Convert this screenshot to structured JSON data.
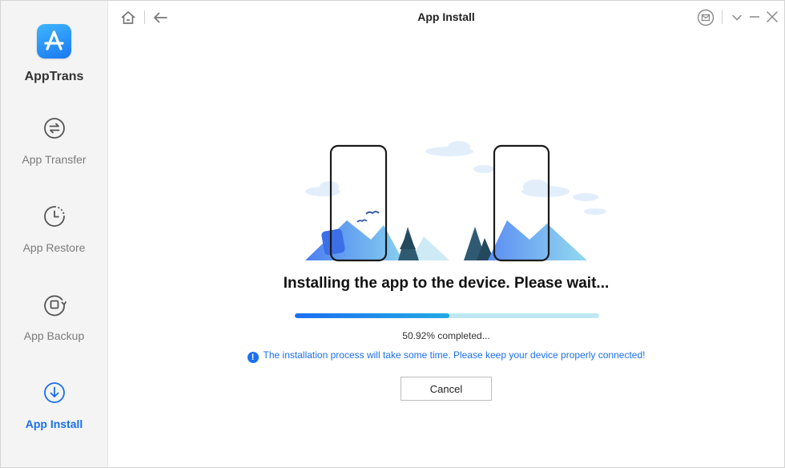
{
  "app": {
    "name": "AppTrans"
  },
  "sidebar": {
    "items": [
      {
        "label": "App Transfer",
        "icon": "swap-arrows-icon",
        "active": false
      },
      {
        "label": "App Restore",
        "icon": "clock-restore-icon",
        "active": false
      },
      {
        "label": "App Backup",
        "icon": "backup-icon",
        "active": false
      },
      {
        "label": "App Install",
        "icon": "download-icon",
        "active": true
      }
    ]
  },
  "titlebar": {
    "title": "App Install",
    "icons": [
      "home-icon",
      "back-arrow-icon",
      "mail-icon",
      "chevron-down-icon",
      "minimize-icon",
      "close-icon"
    ]
  },
  "main": {
    "headline": "Installing the app to the device. Please wait...",
    "progress": {
      "percent": 50.92,
      "text": "50.92% completed..."
    },
    "notice": "The installation process will take some time. Please keep your device properly connected!",
    "cancel_label": "Cancel"
  },
  "colors": {
    "accent": "#1b6ff0",
    "progress_track": "#bfe7f2",
    "sidebar_bg": "#f4f4f4"
  }
}
